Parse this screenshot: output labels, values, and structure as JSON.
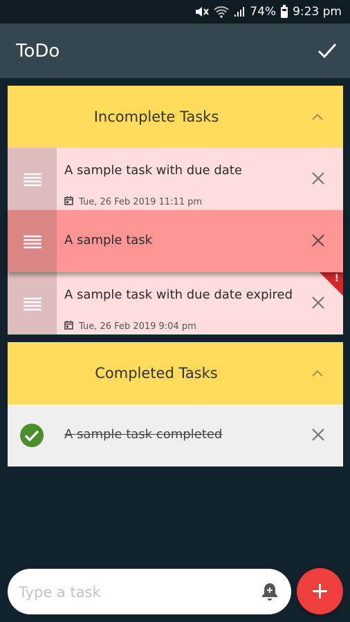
{
  "status_bar": {
    "battery": "74%",
    "time": "9:23 pm"
  },
  "app_bar": {
    "title": "ToDo",
    "action_icon": "check-icon"
  },
  "incomplete_section": {
    "title": "Incomplete Tasks",
    "tasks": [
      {
        "text": "A sample task with due date",
        "due": "Tue, 26 Feb 2019 11:11 pm"
      },
      {
        "text": "A sample task"
      },
      {
        "text": "A sample task with due date expired",
        "due": "Tue, 26 Feb 2019 9:04 pm",
        "expired_flag": "!"
      }
    ]
  },
  "completed_section": {
    "title": "Completed Tasks",
    "tasks": [
      {
        "text": "A sample task completed"
      }
    ]
  },
  "input": {
    "placeholder": "Type a task",
    "value": ""
  },
  "colors": {
    "app_background": "#12222d",
    "app_bar": "#344650",
    "section_header": "#fedb5b",
    "task_row": "#fddddd",
    "task_row_highlight": "#fd9595",
    "completed_row": "#efefef",
    "fab": "#ee3e3e",
    "complete_check": "#4a8f2c",
    "expired_flag": "#d62828"
  }
}
